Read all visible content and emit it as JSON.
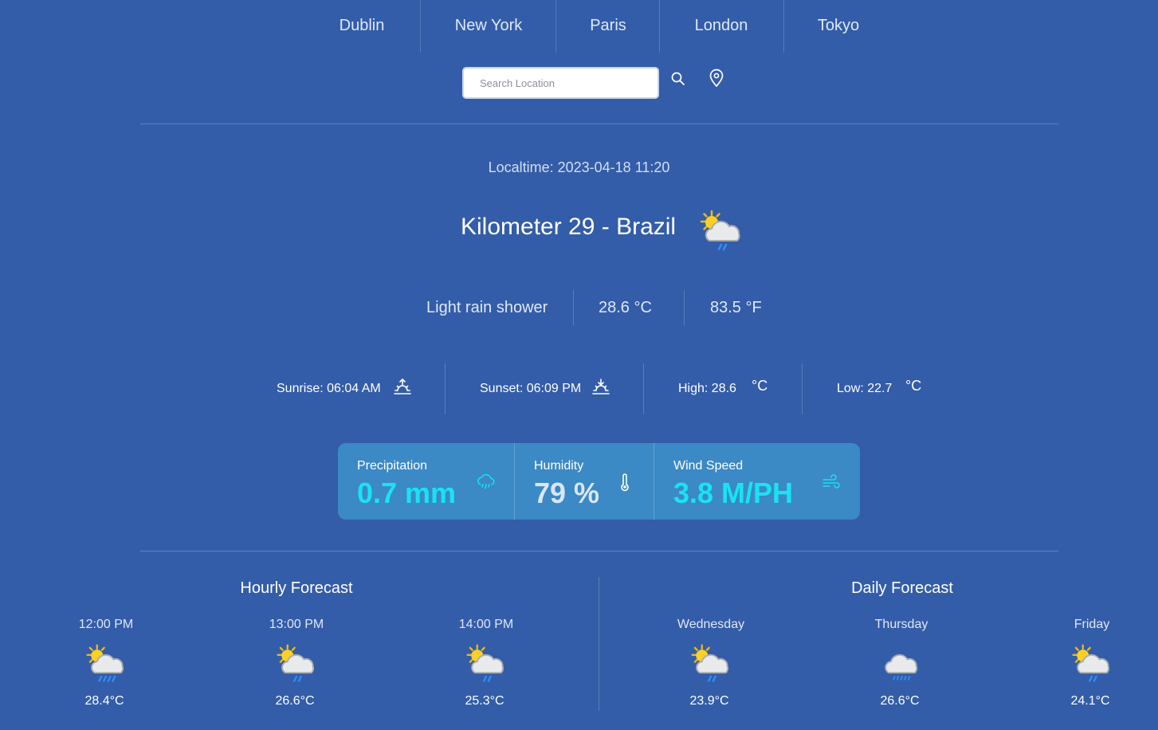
{
  "nav": {
    "cities": [
      "Dublin",
      "New York",
      "Paris",
      "London",
      "Tokyo"
    ]
  },
  "search": {
    "placeholder": "Search Location",
    "search_icon": "search-icon",
    "location_icon": "map-pin-icon"
  },
  "current": {
    "localtime": "Localtime: 2023-04-18 11:20",
    "location": "Kilometer 29 - Brazil",
    "icon": "partly-cloudy-rain-icon",
    "condition": "Light rain shower",
    "temp_c": "28.6 °C",
    "temp_f": "83.5 °F"
  },
  "sun": {
    "sunrise": "Sunrise: 06:04 AM",
    "sunset": "Sunset: 06:09 PM",
    "high": "High: 28.6",
    "low": "Low: 22.7",
    "unit": "°C"
  },
  "stats": {
    "precipitation_label": "Precipitation",
    "precipitation_value": "0.7 mm",
    "humidity_label": "Humidity",
    "humidity_value": "79 %",
    "wind_label": "Wind Speed",
    "wind_value": "3.8 M/PH"
  },
  "hourly": {
    "title": "Hourly Forecast",
    "items": [
      {
        "time": "12:00 PM",
        "temp": "28.4°C",
        "icon": "partly-cloudy-heavy-rain-icon"
      },
      {
        "time": "13:00 PM",
        "temp": "26.6°C",
        "icon": "partly-cloudy-rain-icon"
      },
      {
        "time": "14:00 PM",
        "temp": "25.3°C",
        "icon": "partly-cloudy-rain-icon"
      }
    ]
  },
  "daily": {
    "title": "Daily Forecast",
    "items": [
      {
        "day": "Wednesday",
        "temp": "23.9°C",
        "icon": "partly-cloudy-rain-icon"
      },
      {
        "day": "Thursday",
        "temp": "26.6°C",
        "icon": "cloudy-rain-icon"
      },
      {
        "day": "Friday",
        "temp": "24.1°C",
        "icon": "partly-cloudy-rain-icon"
      }
    ]
  },
  "colors": {
    "background": "#335da9",
    "card": "#3b89c5",
    "accent_cyan": "#19e3f2",
    "light_value": "#dbe6f3"
  }
}
